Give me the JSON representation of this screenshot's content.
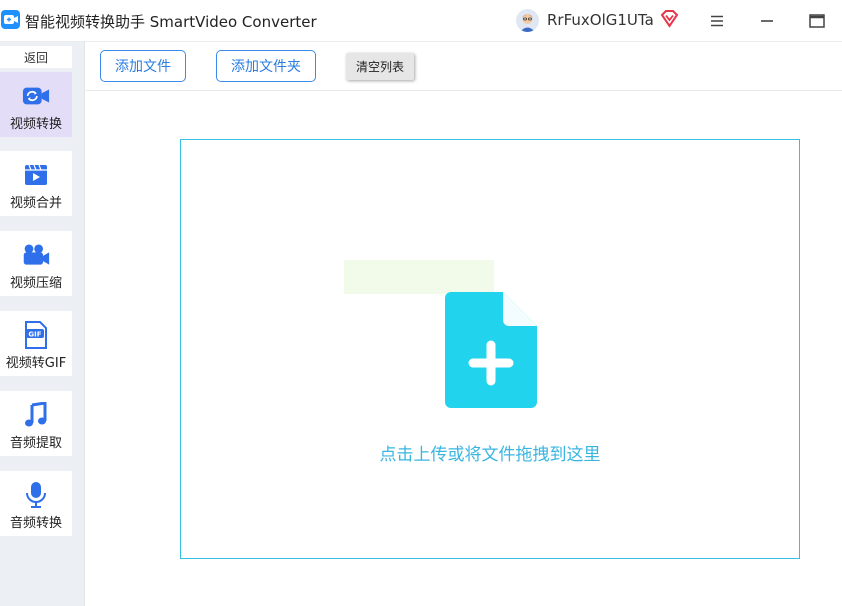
{
  "window": {
    "title": "智能视频转换助手 SmartVideo Converter",
    "user_name": "RrFuxOlG1UTa",
    "icons": {
      "app_logo": "app-logo-icon",
      "avatar": "avatar",
      "vip": "vip-diamond-icon",
      "menu": "hamburger-menu-icon",
      "minimize": "minimize-icon",
      "maximize": "maximize-icon"
    }
  },
  "sidebar": {
    "back_label": "返回",
    "items": [
      {
        "label": "视频转换",
        "icon": "video-convert-icon",
        "active": true
      },
      {
        "label": "视频合并",
        "icon": "video-merge-icon",
        "active": false
      },
      {
        "label": "视频压缩",
        "icon": "video-compress-icon",
        "active": false
      },
      {
        "label": "视频转GIF",
        "icon": "gif-icon",
        "active": false
      },
      {
        "label": "音频提取",
        "icon": "music-note-icon",
        "active": false
      },
      {
        "label": "音频转换",
        "icon": "microphone-icon",
        "active": false
      }
    ]
  },
  "toolbar": {
    "add_file_label": "添加文件",
    "add_folder_label": "添加文件夹",
    "clear_list_label": "清空列表"
  },
  "dropzone": {
    "hint": "点击上传或将文件拖拽到这里",
    "icon": "file-add-icon"
  },
  "colors": {
    "accent_blue": "#2a7de1",
    "drop_cyan": "#22d3ee",
    "sidebar_active": "#e4ddf7",
    "vip_red": "#e8354a"
  }
}
